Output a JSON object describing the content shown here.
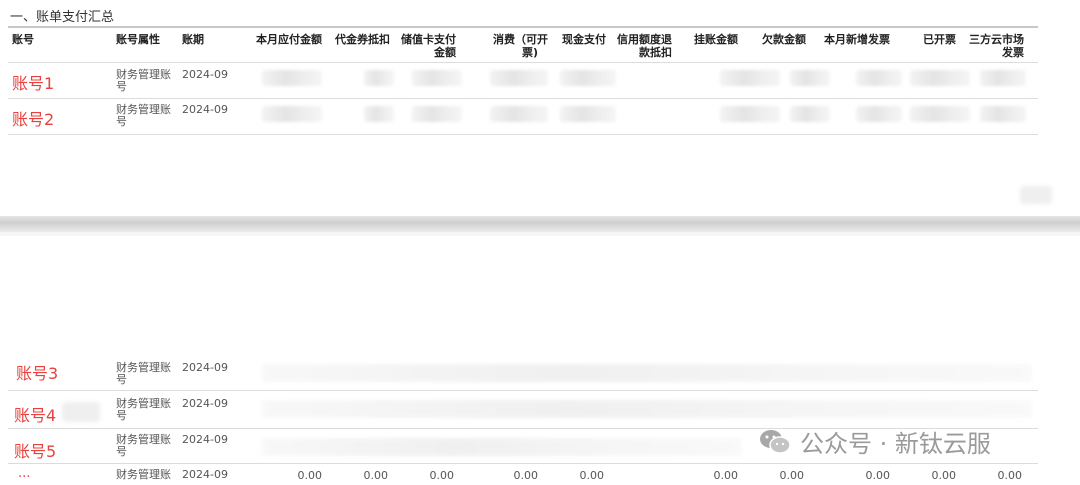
{
  "section_title": "一、账单支付汇总",
  "headers": {
    "account": "账号",
    "attr": "账号属性",
    "period": "账期",
    "due": "本月应付金额",
    "voucher": "代金券抵扣",
    "stored_l1": "储值卡支付",
    "stored_l2": "金额",
    "consume_l1": "消费（可开",
    "consume_l2": "票)",
    "cash": "现金支付",
    "credit_l1": "信用额度退",
    "credit_l2": "款抵扣",
    "hang": "挂账金额",
    "owe": "欠款金额",
    "newinv": "本月新增发票",
    "issued": "已开票",
    "market_l1": "三方云市场",
    "market_l2": "发票"
  },
  "rows_top": [
    {
      "account": "账号1",
      "attr_l1": "财务管理账",
      "attr_l2": "号",
      "period": "2024-09"
    },
    {
      "account": "账号2",
      "attr_l1": "财务管理账",
      "attr_l2": "号",
      "period": "2024-09"
    }
  ],
  "rows_bottom": [
    {
      "account": "账号3",
      "attr_l1": "财务管理账",
      "attr_l2": "号",
      "period": "2024-09"
    },
    {
      "account": "账号4",
      "attr_l1": "财务管理账",
      "attr_l2": "号",
      "period": "2024-09"
    },
    {
      "account": "账号5",
      "attr_l1": "财务管理账",
      "attr_l2": "号",
      "period": "2024-09"
    },
    {
      "account": "...",
      "attr_l1": "财务管理账",
      "attr_l2": "",
      "period": "2024-09",
      "values": [
        "0.00",
        "0.00",
        "0.00",
        "0.00",
        "0.00",
        "0.00",
        "0.00",
        "0.00",
        "0.00",
        "0.00"
      ]
    }
  ],
  "watermark": "公众号 · 新钛云服"
}
